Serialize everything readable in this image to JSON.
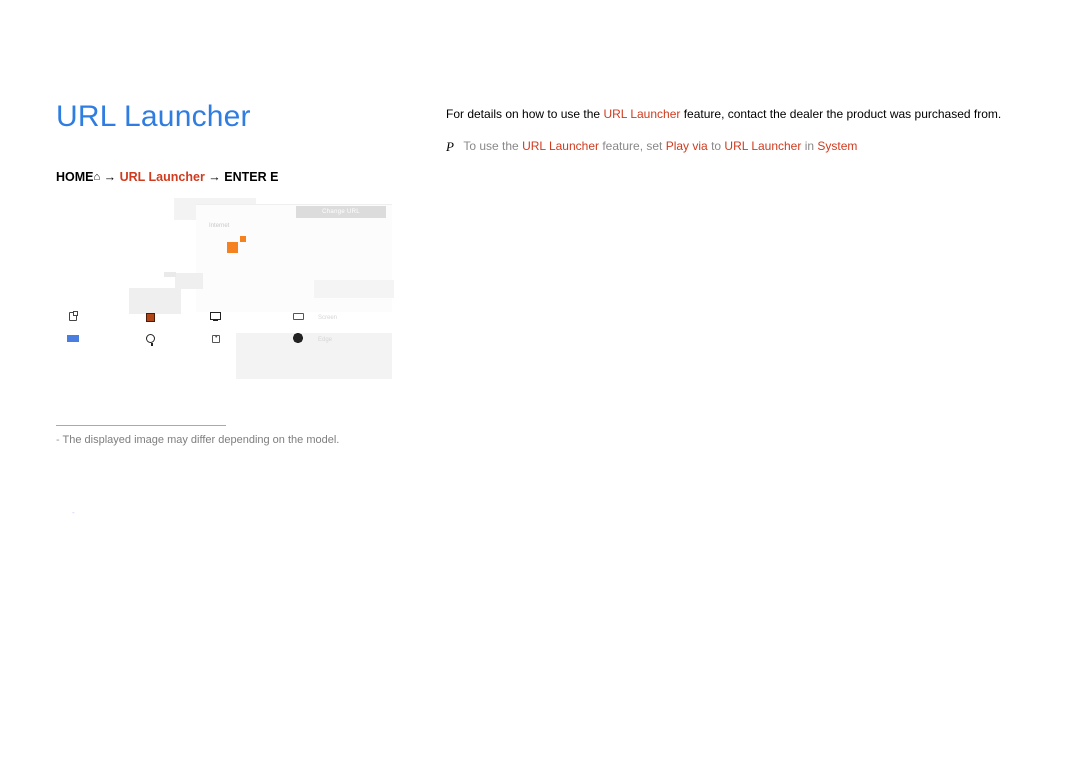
{
  "title": "URL Launcher",
  "path": {
    "home": "HOME",
    "arrow": " → ",
    "item": "URL Launcher",
    "enter": "ENTER E"
  },
  "details": {
    "prefix": "For details on how to use the ",
    "feature": "URL Launcher",
    "suffix": " feature, contact the dealer the product was purchased from."
  },
  "note": {
    "marker": "P",
    "pre": "To use the ",
    "feat": "URL Launcher",
    "mid1": " feature, set ",
    "playvia": "Play via",
    "mid2": " to ",
    "target": "URL Launcher",
    "mid3": " in ",
    "system": "System"
  },
  "shot": {
    "change_url": "Change URL",
    "internet": "Internet",
    "row1_label": "Screen",
    "row2_label": "Edge"
  },
  "disclaimer": {
    "dash": "- ",
    "text": "The displayed image may differ depending on the model."
  },
  "page_num": "-"
}
